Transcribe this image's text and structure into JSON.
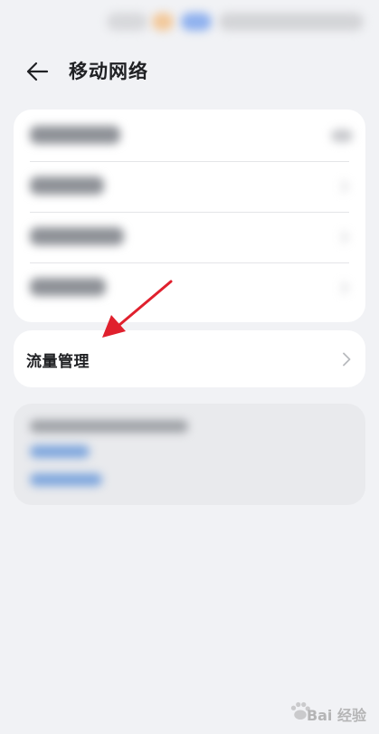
{
  "header": {
    "title": "移动网络"
  },
  "flow_management": {
    "label": "流量管理"
  },
  "watermark": {
    "text": "Bai 经验"
  },
  "colors": {
    "background": "#f1f2f5",
    "card": "#ffffff",
    "annotation_arrow": "#e0202d"
  },
  "icons": [
    "back-arrow-icon",
    "chevron-right-icon"
  ]
}
